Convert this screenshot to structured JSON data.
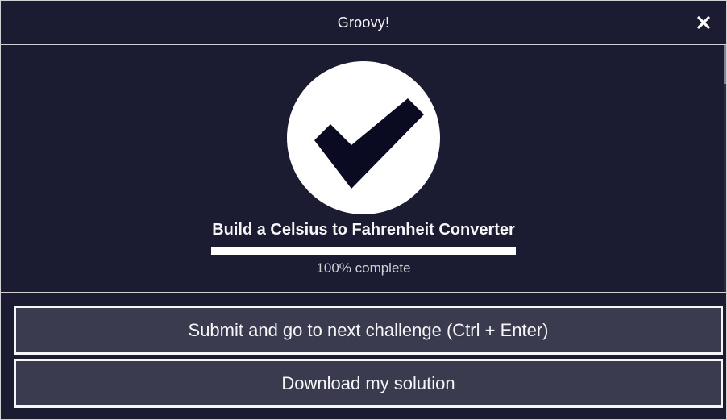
{
  "modal": {
    "title": "Groovy!",
    "close_icon": "close-icon"
  },
  "completion": {
    "icon": "checkmark-icon",
    "challenge_title": "Build a Celsius to Fahrenheit Converter",
    "progress_percent": 100,
    "progress_text": "100% complete"
  },
  "actions": {
    "submit_label": "Submit and go to next challenge (Ctrl + Enter)",
    "download_label": "Download my solution"
  },
  "colors": {
    "background": "#1b1b32",
    "button_background": "#3b3b4f",
    "text": "#f5f6f7",
    "check_mark": "#0a0a23"
  }
}
